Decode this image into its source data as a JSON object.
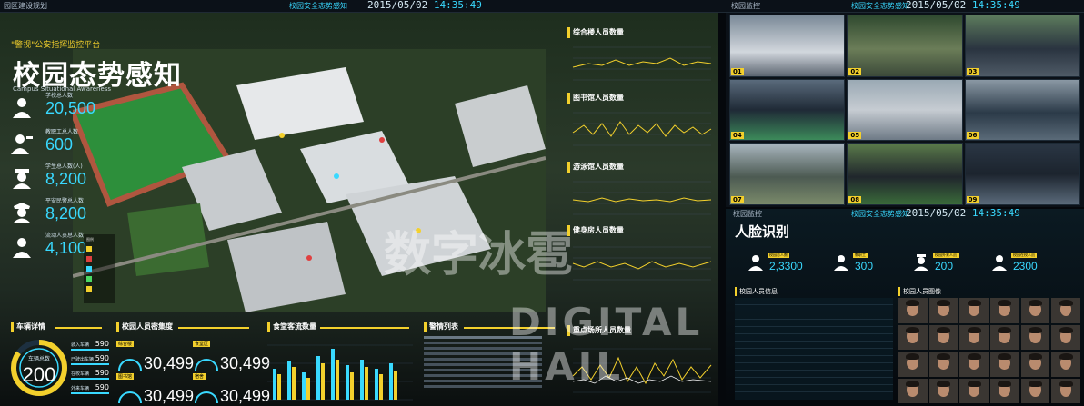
{
  "topbar": {
    "left_label": "园区建设规划",
    "center_title": "校园安全态势感知",
    "center_date": "2015/05/02",
    "center_time": "14:35:49",
    "right_label": "校园监控",
    "right_title": "校园安全态势感知",
    "right_date": "2015/05/02",
    "right_time": "14:35:49"
  },
  "left": {
    "platform": "\"警视\"公安指挥监控平台",
    "title": "校园态势感知",
    "subtitle": "Campus Situational Awareness",
    "stats": [
      {
        "label": "学校总人数",
        "value": "20,500",
        "icon": "person-icon"
      },
      {
        "label": "教职工总人数",
        "value": "600",
        "icon": "teacher-icon"
      },
      {
        "label": "学生总人数(人)",
        "value": "8,200",
        "icon": "student-icon"
      },
      {
        "label": "平安民警总人数",
        "value": "8,200",
        "icon": "police-icon"
      },
      {
        "label": "流动人员总人数",
        "value": "4,100",
        "icon": "visitor-icon"
      }
    ],
    "legend_title": "图例",
    "charts": {
      "complex": "综合楼人员数量",
      "library": "图书馆人员数量",
      "swimming": "游泳馆人员数量",
      "gym": "健身房人员数量",
      "key_area": "重点场所人员数量"
    },
    "vehicle": {
      "title": "车辆详情",
      "ring_label": "车辆总数",
      "ring_value": "200",
      "ring_fraction": 0.85,
      "rows": [
        {
          "label": "驶入车辆",
          "value": "590"
        },
        {
          "label": "已驶出车辆",
          "value": "590"
        },
        {
          "label": "在校车辆",
          "value": "590"
        },
        {
          "label": "外来车辆",
          "value": "590"
        }
      ]
    },
    "density": {
      "title": "校园人员密集度",
      "gauges": [
        {
          "label": "综合楼",
          "value": "30,499"
        },
        {
          "label": "图书馆",
          "value": "30,499"
        },
        {
          "label": "食堂区",
          "value": "30,499"
        },
        {
          "label": "宿舍",
          "value": "30,499"
        }
      ]
    },
    "canteen": {
      "title": "食堂客流数量"
    },
    "alarm": {
      "title": "警情列表"
    }
  },
  "face": {
    "title": "人脸识别",
    "header_label": "校园监控",
    "stats": [
      {
        "label": "校园总人数",
        "value": "2,3300"
      },
      {
        "label": "教职工",
        "value": "300"
      },
      {
        "label": "校园外来人员",
        "value": "200"
      },
      {
        "label": "校园在校人员",
        "value": "2300"
      }
    ],
    "table_title": "校园人员信息",
    "grid_title": "校园人员图像"
  },
  "cameras": [
    "01",
    "02",
    "03",
    "04",
    "05",
    "06",
    "07",
    "08",
    "09"
  ],
  "watermark": {
    "cn": "数字冰雹",
    "en": "DIGITAL HAIL"
  },
  "colors": {
    "accent": "#39d9ff",
    "highlight": "#f3d02c",
    "bg": "#05080c"
  }
}
